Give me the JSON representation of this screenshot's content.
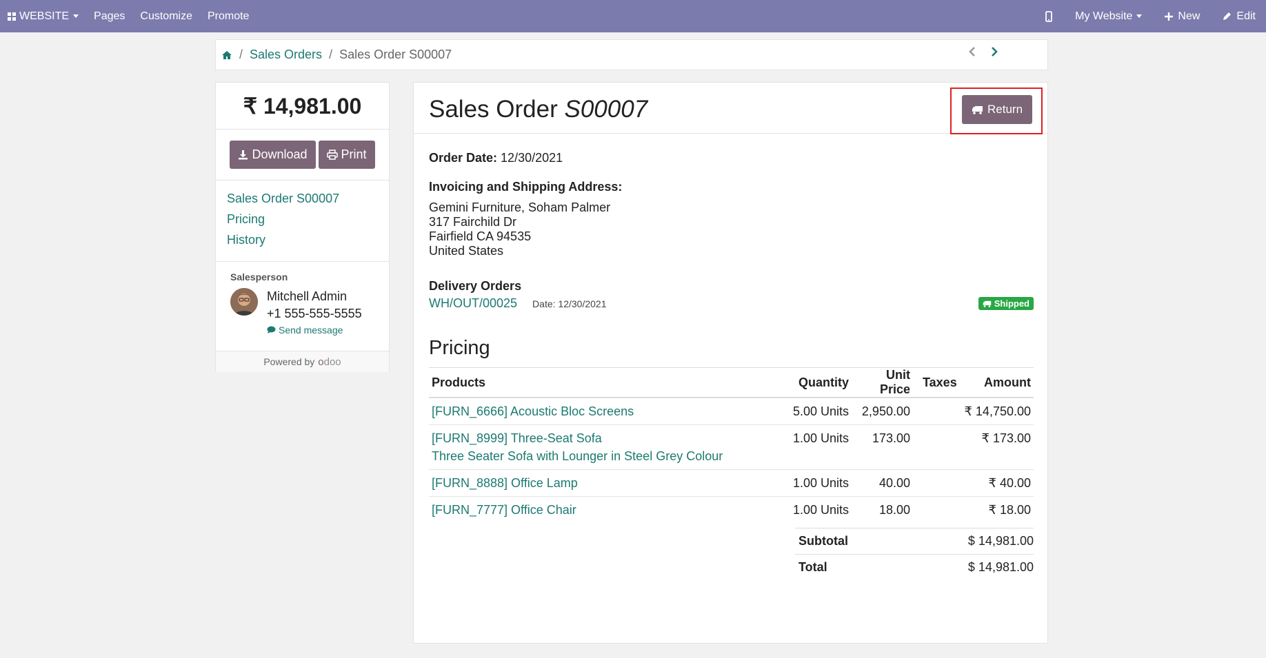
{
  "topbar": {
    "app_label": "WEBSITE",
    "menu": [
      "Pages",
      "Customize",
      "Promote"
    ],
    "website_selector": "My Website",
    "new_label": "New",
    "edit_label": "Edit"
  },
  "breadcrumb": {
    "items": [
      "Sales Orders"
    ],
    "current": "Sales Order S00007"
  },
  "sidebar": {
    "amount": "₹ 14,981.00",
    "download_label": "Download",
    "print_label": "Print",
    "nav": [
      "Sales Order S00007",
      "Pricing",
      "History"
    ],
    "salesperson_label": "Salesperson",
    "salesperson_name": "Mitchell Admin",
    "salesperson_phone": "+1 555-555-5555",
    "send_message_label": "Send message",
    "powered_by": "Powered by",
    "odoo_logo": "odoo"
  },
  "order": {
    "title_prefix": "Sales Order",
    "number": "S00007",
    "return_label": "Return",
    "order_date_label": "Order Date:",
    "order_date": "12/30/2021",
    "address_heading": "Invoicing and Shipping Address:",
    "address_lines": [
      "Gemini Furniture, Soham Palmer",
      "317 Fairchild Dr",
      "Fairfield CA 94535",
      "United States"
    ],
    "delivery_heading": "Delivery Orders",
    "delivery_ref": "WH/OUT/00025",
    "delivery_date_label": "Date:",
    "delivery_date": "12/30/2021",
    "delivery_status": "Shipped"
  },
  "pricing": {
    "heading": "Pricing",
    "columns": [
      "Products",
      "Quantity",
      "Unit Price",
      "Taxes",
      "Amount"
    ],
    "rows": [
      {
        "product": "[FURN_6666] Acoustic Bloc Screens",
        "desc": "",
        "qty": "5.00 Units",
        "unit_price": "2,950.00",
        "taxes": "",
        "amount": "₹ 14,750.00"
      },
      {
        "product": "[FURN_8999] Three-Seat Sofa",
        "desc": "Three Seater Sofa with Lounger in Steel Grey Colour",
        "qty": "1.00 Units",
        "unit_price": "173.00",
        "taxes": "",
        "amount": "₹ 173.00"
      },
      {
        "product": "[FURN_8888] Office Lamp",
        "desc": "",
        "qty": "1.00 Units",
        "unit_price": "40.00",
        "taxes": "",
        "amount": "₹ 40.00"
      },
      {
        "product": "[FURN_7777] Office Chair",
        "desc": "",
        "qty": "1.00 Units",
        "unit_price": "18.00",
        "taxes": "",
        "amount": "₹ 18.00"
      }
    ],
    "subtotal_label": "Subtotal",
    "subtotal": "$ 14,981.00",
    "total_label": "Total",
    "total": "$ 14,981.00"
  },
  "colors": {
    "topbar": "#7c7bad",
    "link": "#1c7a72",
    "button": "#7c6577",
    "shipped": "#28a745",
    "highlight": "#e02020"
  }
}
